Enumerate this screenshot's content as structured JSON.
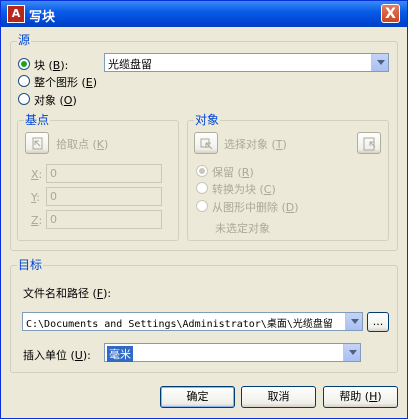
{
  "window": {
    "title": "写块",
    "app_icon": "A",
    "close_label": "X"
  },
  "source": {
    "legend": "源",
    "radios": [
      {
        "label": "块",
        "key": "B",
        "checked": true
      },
      {
        "label": "整个图形",
        "key": "E",
        "checked": false
      },
      {
        "label": "对象",
        "key": "O",
        "checked": false
      }
    ],
    "block_select_value": "光缆盘留"
  },
  "basepoint": {
    "legend": "基点",
    "pick_label": "拾取点",
    "pick_key": "K",
    "x_label": "X",
    "x_value": "0",
    "y_label": "Y",
    "y_value": "0",
    "z_label": "Z",
    "z_value": "0"
  },
  "objects": {
    "legend": "对象",
    "select_label": "选择对象",
    "select_key": "T",
    "radios": [
      {
        "label": "保留",
        "key": "R",
        "checked": true
      },
      {
        "label": "转换为块",
        "key": "C",
        "checked": false
      },
      {
        "label": "从图形中删除",
        "key": "D",
        "checked": false
      }
    ],
    "status": "未选定对象"
  },
  "target": {
    "legend": "目标",
    "path_label": "文件名和路径",
    "path_key": "F",
    "path_value": "C:\\Documents and Settings\\Administrator\\桌面\\光缆盘留",
    "browse_label": "...",
    "units_label": "插入单位",
    "units_key": "U",
    "units_value": "毫米"
  },
  "buttons": {
    "ok": "确定",
    "cancel": "取消",
    "help": "帮助",
    "help_key": "H"
  }
}
